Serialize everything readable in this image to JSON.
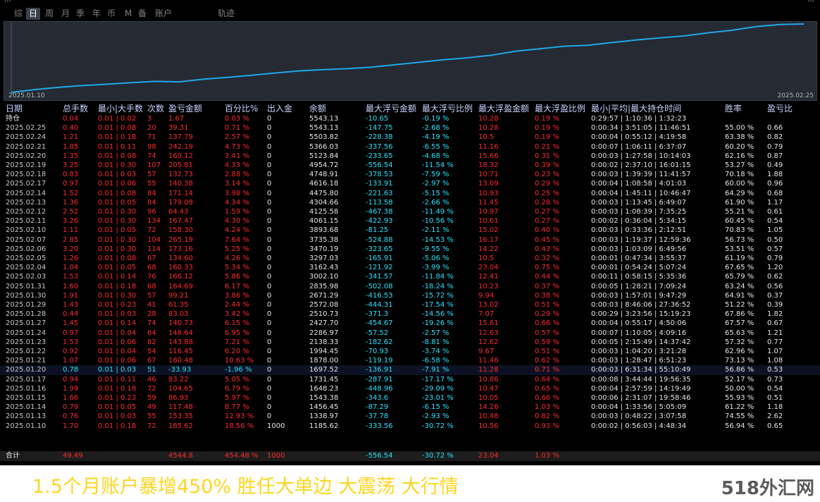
{
  "titlebar": {
    "left_text": "...",
    "right_text": "..."
  },
  "tabs": [
    {
      "label": "综",
      "active": false
    },
    {
      "label": "日",
      "active": true
    },
    {
      "label": "周",
      "active": false
    },
    {
      "label": "月",
      "active": false
    },
    {
      "label": "季",
      "active": false
    },
    {
      "label": "年",
      "active": false
    },
    {
      "label": "币",
      "active": false
    },
    {
      "label": "M",
      "active": false
    },
    {
      "label": "备",
      "active": false
    },
    {
      "label": "账户",
      "active": false
    },
    {
      "label": "轨迹",
      "active": false
    }
  ],
  "chart": {
    "start_label": "2025.01.10",
    "end_label": "2025.02.25",
    "line_color": "#1fa8e8"
  },
  "columns": [
    "日期",
    "总手数",
    "最小|大手数",
    "次数",
    "盈亏金额",
    "百分比%",
    "出入金",
    "余额",
    "最大浮亏金额",
    "最大浮亏比例",
    "最大浮盈金额",
    "最大浮盈比例",
    "最小|平均|最大持仓时间",
    "胜率",
    "盈亏比"
  ],
  "rows": [
    [
      "持仓",
      "0.04",
      "0.01 | 0.02",
      "3",
      "1.67",
      "0.03 %",
      "0",
      "5543.13",
      "-10.65",
      "-0.19 %",
      "10.28",
      "0.19 %",
      "0:29:57 | 1:10:36 | 1:32:23",
      "",
      ""
    ],
    [
      "2025.02.25",
      "0.40",
      "0.01 | 0.08",
      "20",
      "39.31",
      "0.71 %",
      "0",
      "5543.13",
      "-147.75",
      "-2.68 %",
      "10.28",
      "0.19 %",
      "0:00:34 | 3:51:05 | 11:46:51",
      "55.00 %",
      "0.66"
    ],
    [
      "2025.02.24",
      "1.21",
      "0.01 | 0.18",
      "71",
      "137.79",
      "2.57 %",
      "0",
      "5503.82",
      "-228.38",
      "-4.19 %",
      "10.5",
      "0.19 %",
      "0:00:04 | 0:55:12 | 4:19:58",
      "63.38 %",
      "0.82"
    ],
    [
      "2025.02.21",
      "1.85",
      "0.01 | 0.11",
      "98",
      "242.19",
      "4.73 %",
      "0",
      "5366.03",
      "-337.56",
      "-6.55 %",
      "11.16",
      "0.21 %",
      "0:00:07 | 1:06:11 | 6:37:07",
      "60.20 %",
      "0.79"
    ],
    [
      "2025.02.20",
      "1.35",
      "0.01 | 0.08",
      "74",
      "169.12",
      "3.41 %",
      "0",
      "5123.84",
      "-233.65",
      "-4.68 %",
      "15.66",
      "0.31 %",
      "0:00:03 | 1:27:58 | 10:14:03",
      "62.16 %",
      "0.87"
    ],
    [
      "2025.02.19",
      "3.25",
      "0.01 | 0.30",
      "107",
      "205.81",
      "4.33 %",
      "0",
      "4954.72",
      "-556.54",
      "-11.54 %",
      "18.32",
      "0.39 %",
      "0:00:02 | 2:37:10 | 16:01:15",
      "53.27 %",
      "0.49"
    ],
    [
      "2025.02.18",
      "0.83",
      "0.01 | 0.03",
      "57",
      "132.73",
      "2.88 %",
      "0",
      "4748.91",
      "-378.53",
      "-7.59 %",
      "10.71",
      "0.23 %",
      "0:00:03 | 1:39:39 | 11:41:57",
      "70.18 %",
      "1.88"
    ],
    [
      "2025.02.17",
      "0.97",
      "0.01 | 0.06",
      "55",
      "140.38",
      "3.14 %",
      "0",
      "4616.18",
      "-133.91",
      "-2.97 %",
      "13.09",
      "0.29 %",
      "0:00:04 | 1:08:58 | 4:01:03",
      "60.00 %",
      "0.96"
    ],
    [
      "2025.02.14",
      "1.52",
      "0.01 | 0.08",
      "84",
      "171.14",
      "3.98 %",
      "0",
      "4475.80",
      "-221.63",
      "-5.15 %",
      "10.93",
      "0.25 %",
      "0:00:04 | 1:45:11 | 10:46:47",
      "64.29 %",
      "0.68"
    ],
    [
      "2025.02.13",
      "1.36",
      "0.01 | 0.05",
      "84",
      "179.08",
      "4.34 %",
      "0",
      "4304.66",
      "-113.58",
      "-2.66 %",
      "11.45",
      "0.28 %",
      "0:00:03 | 1:13:45 | 6:49:07",
      "61.90 %",
      "1.17"
    ],
    [
      "2025.02.12",
      "2.52",
      "0.01 | 0.30",
      "96",
      "64.43",
      "1.59 %",
      "0",
      "4125.58",
      "-467.38",
      "-11.49 %",
      "10.97",
      "0.27 %",
      "0:00:03 | 1:08:39 | 7:35:25",
      "55.21 %",
      "0.61"
    ],
    [
      "2025.02.11",
      "3.26",
      "0.01 | 0.30",
      "134",
      "167.47",
      "4.30 %",
      "0",
      "4061.15",
      "-422.93",
      "-10.56 %",
      "10.61",
      "0.27 %",
      "0:00:02 | 0:36:04 | 5:34:15",
      "60.45 %",
      "0.54"
    ],
    [
      "2025.02.10",
      "1.11",
      "0.01 | 0.05",
      "72",
      "158.30",
      "4.24 %",
      "0",
      "3893.68",
      "-81.25",
      "-2.11 %",
      "15.02",
      "0.40 %",
      "0:00:03 | 0:33:36 | 2:12:51",
      "70.83 %",
      "1.05"
    ],
    [
      "2025.02.07",
      "2.85",
      "0.01 | 0.30",
      "104",
      "265.19",
      "7.64 %",
      "0",
      "3735.38",
      "-524.88",
      "-14.53 %",
      "16.17",
      "0.45 %",
      "0:00:03 | 1:19:37 | 12:59:36",
      "56.73 %",
      "0.50"
    ],
    [
      "2025.02.06",
      "3.20",
      "0.01 | 0.30",
      "114",
      "173.16",
      "5.25 %",
      "0",
      "3470.19",
      "-323.65",
      "-9.55 %",
      "14.22",
      "0.43 %",
      "0:00:03 | 1:03:09 | 6:49:56",
      "53.51 %",
      "0.57"
    ],
    [
      "2025.02.05",
      "1.26",
      "0.01 | 0.08",
      "67",
      "134.60",
      "4.26 %",
      "0",
      "3297.03",
      "-165.91",
      "-5.06 %",
      "10.5",
      "0.32 %",
      "0:00:01 | 0:47:34 | 3:55:37",
      "61.19 %",
      "0.79"
    ],
    [
      "2025.02.04",
      "1.04",
      "0.01 | 0.05",
      "68",
      "160.33",
      "5.34 %",
      "0",
      "3162.43",
      "-121.92",
      "-3.99 %",
      "23.04",
      "0.75 %",
      "0:00:01 | 0:54:24 | 5:07:24",
      "67.65 %",
      "1.20"
    ],
    [
      "2025.02.03",
      "1.53",
      "0.01 | 0.14",
      "76",
      "166.12",
      "5.86 %",
      "0",
      "3002.10",
      "-341.57",
      "-11.84 %",
      "12.41",
      "0.44 %",
      "0:00:11 | 0:58:15 | 5:35:36",
      "65.79 %",
      "0.62"
    ],
    [
      "2025.01.31",
      "1.60",
      "0.01 | 0.18",
      "68",
      "164.69",
      "6.17 %",
      "0",
      "2835.98",
      "-502.08",
      "-18.24 %",
      "10.23",
      "0.37 %",
      "0:00:05 | 1:28:21 | 7:09:24",
      "63.24 %",
      "0.56"
    ],
    [
      "2025.01.30",
      "1.91",
      "0.01 | 0.30",
      "57",
      "99.21",
      "3.86 %",
      "0",
      "2671.29",
      "-416.53",
      "-15.72 %",
      "9.94",
      "0.38 %",
      "0:00:03 | 1:57:01 | 9:47:29",
      "64.91 %",
      "0.37"
    ],
    [
      "2025.01.29",
      "1.43",
      "0.01 | 0.23",
      "41",
      "61.35",
      "2.44 %",
      "0",
      "2572.08",
      "-444.31",
      "-17.54 %",
      "13.02",
      "0.51 %",
      "0:00:03 | 8:46:06 | 27:36:52",
      "51.22 %",
      "0.39"
    ],
    [
      "2025.01.28",
      "0.44",
      "0.01 | 0.03",
      "28",
      "83.03",
      "3.42 %",
      "0",
      "2510.73",
      "-371.3",
      "-14.56 %",
      "7.07",
      "0.29 %",
      "0:00:29 | 3:23:56 | 15:19:23",
      "67.86 %",
      "1.82"
    ],
    [
      "2025.01.27",
      "1.45",
      "0.01 | 0.14",
      "74",
      "140.73",
      "6.15 %",
      "0",
      "2427.70",
      "-454.67",
      "-19.26 %",
      "15.61",
      "0.66 %",
      "0:00:04 | 0:55:17 | 4:50:06",
      "67.57 %",
      "0.67"
    ],
    [
      "2025.01.24",
      "0.97",
      "0.01 | 0.04",
      "64",
      "148.64",
      "6.95 %",
      "0",
      "2286.97",
      "-57.52",
      "-2.57 %",
      "12.63",
      "0.57 %",
      "0:00:07 | 1:10:05 | 4:09:16",
      "65.63 %",
      "1.21"
    ],
    [
      "2025.01.23",
      "1.53",
      "0.01 | 0.06",
      "82",
      "143.88",
      "7.21 %",
      "0",
      "2138.33",
      "-182.62",
      "-8.81 %",
      "12.62",
      "0.59 %",
      "0:00:05 | 2:15:49 | 14:37:42",
      "57.32 %",
      "0.77"
    ],
    [
      "2025.01.22",
      "0.92",
      "0.01 | 0.04",
      "54",
      "116.45",
      "6.20 %",
      "0",
      "1994.45",
      "-70.93",
      "-3.74 %",
      "9.67",
      "0.51 %",
      "0:00:03 | 1:04:20 | 3:21:28",
      "62.96 %",
      "1.07"
    ],
    [
      "2025.01.21",
      "1.07",
      "0.01 | 0.06",
      "67",
      "180.48",
      "10.63 %",
      "0",
      "1878.00",
      "-119.19",
      "-6.58 %",
      "11.46",
      "0.62 %",
      "0:00:03 | 1:28:47 | 6:51:23",
      "73.13 %",
      "1.08"
    ],
    [
      "2025.01.20",
      "0.78",
      "0.01 | 0.03",
      "51",
      "-33.93",
      "-1.96 %",
      "0",
      "1697.52",
      "-136.91",
      "-7.91 %",
      "11.28",
      "0.71 %",
      "0:00:03 | 6:31:34 | 55:10:49",
      "56.86 %",
      "0.53"
    ],
    [
      "2025.01.17",
      "0.94",
      "0.01 | 0.11",
      "46",
      "83.22",
      "5.05 %",
      "0",
      "1731.45",
      "-287.91",
      "-17.17 %",
      "10.86",
      "0.64 %",
      "0:00:08 | 3:44:44 | 19:56:35",
      "52.17 %",
      "0.73"
    ],
    [
      "2025.01.16",
      "1.99",
      "0.01 | 0.18",
      "72",
      "104.65",
      "6.79 %",
      "0",
      "1648.23",
      "-448.96",
      "-29.09 %",
      "10.47",
      "0.65 %",
      "0:00:04 | 2:57:59 | 14:19:49",
      "50.00 %",
      "0.54"
    ],
    [
      "2025.01.15",
      "1.66",
      "0.01 | 0.23",
      "59",
      "86.93",
      "5.97 %",
      "0",
      "1543.38",
      "-343.6",
      "-23.01 %",
      "10.05",
      "0.66 %",
      "0:00:06 | 2:31:07 | 19:58:46",
      "55.93 %",
      "0.51"
    ],
    [
      "2025.01.14",
      "0.79",
      "0.01 | 0.05",
      "49",
      "117.48",
      "8.77 %",
      "0",
      "1456.45",
      "-87.29",
      "-6.15 %",
      "14.26",
      "1.03 %",
      "0:00:04 | 1:33:56 | 5:05:09",
      "61.22 %",
      "1.18"
    ],
    [
      "2025.01.13",
      "0.76",
      "0.01 | 0.03",
      "55",
      "153.35",
      "12.93 %",
      "0",
      "1338.97",
      "-37.78",
      "-2.93 %",
      "10.48",
      "0.82 %",
      "0:00:03 | 0:48:22 | 3:07:58",
      "74.55 %",
      "2.62"
    ],
    [
      "2025.01.10",
      "1.70",
      "0.01 | 0.18",
      "72",
      "185.62",
      "18.56 %",
      "1000",
      "1185.62",
      "-333.56",
      "-30.72 %",
      "10.56",
      "0.93 %",
      "0:00:02 | 0:56:03 | 4:48:34",
      "56.94 %",
      "0.65"
    ]
  ],
  "totals": [
    "合计",
    "49.49",
    "",
    "",
    "4544.8",
    "454.48 %",
    "1000",
    "",
    "-556.54",
    "-30.72 %",
    "23.04",
    "1.03 %",
    "",
    "",
    ""
  ],
  "caption": "1.5个月账户暴增450%  胜任大单边  大震荡  大行情",
  "brand": "518外汇网",
  "colors": {
    "positive": "#ff2a2a",
    "negative": "#22e6ff",
    "header": "#c8d4ff",
    "caption": "#ffd61e"
  }
}
